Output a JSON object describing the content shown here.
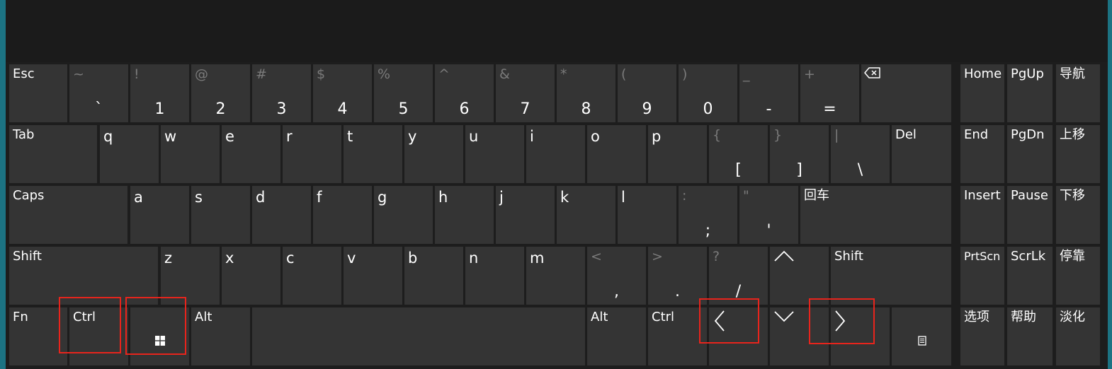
{
  "keys": {
    "esc": "Esc",
    "backtick_top": "~",
    "backtick_bottom": "`",
    "k1_top": "!",
    "k1_bottom": "1",
    "k2_top": "@",
    "k2_bottom": "2",
    "k3_top": "#",
    "k3_bottom": "3",
    "k4_top": "$",
    "k4_bottom": "4",
    "k5_top": "%",
    "k5_bottom": "5",
    "k6_top": "^",
    "k6_bottom": "6",
    "k7_top": "&",
    "k7_bottom": "7",
    "k8_top": "*",
    "k8_bottom": "8",
    "k9_top": "(",
    "k9_bottom": "9",
    "k0_top": ")",
    "k0_bottom": "0",
    "minus_top": "_",
    "minus_bottom": "-",
    "equal_top": "+",
    "equal_bottom": "=",
    "tab": "Tab",
    "q": "q",
    "w": "w",
    "e": "e",
    "r": "r",
    "t": "t",
    "y": "y",
    "u": "u",
    "i": "i",
    "o": "o",
    "p": "p",
    "lbracket_top": "{",
    "lbracket_bottom": "[",
    "rbracket_top": "}",
    "rbracket_bottom": "]",
    "backslash_top": "|",
    "backslash_bottom": "\\",
    "del": "Del",
    "caps": "Caps",
    "a": "a",
    "s": "s",
    "d": "d",
    "f": "f",
    "g": "g",
    "h": "h",
    "j": "j",
    "k": "k",
    "l": "l",
    "semicolon_top": ":",
    "semicolon_bottom": ";",
    "quote_top": "\"",
    "quote_bottom": "'",
    "enter": "回车",
    "shift_left": "Shift",
    "z": "z",
    "x": "x",
    "c": "c",
    "v": "v",
    "b": "b",
    "n": "n",
    "m": "m",
    "comma_top": "<",
    "comma_bottom": ",",
    "period_top": ">",
    "period_bottom": ".",
    "slash_top": "?",
    "slash_bottom": "/",
    "shift_right": "Shift",
    "fn": "Fn",
    "ctrl_left": "Ctrl",
    "alt_left": "Alt",
    "alt_right": "Alt",
    "ctrl_right": "Ctrl"
  },
  "nav": {
    "home": "Home",
    "pgup": "PgUp",
    "navigate": "导航",
    "end": "End",
    "pgdn": "PgDn",
    "move_up": "上移",
    "insert": "Insert",
    "pause": "Pause",
    "move_down": "下移",
    "prtscn": "PrtScn",
    "scrlk": "ScrLk",
    "dock": "停靠",
    "options": "选项",
    "help": "帮助",
    "fade": "淡化"
  },
  "icons": {
    "backspace": "backspace-icon",
    "windows": "windows-logo-icon",
    "up": "arrow-up-icon",
    "left": "arrow-left-icon",
    "down": "arrow-down-icon",
    "right": "arrow-right-icon",
    "menu": "context-menu-icon"
  },
  "colors": {
    "key_bg": "#343434",
    "page_bg": "#1a1a1a",
    "side_bar": "#1c7383",
    "highlight": "#e8241c",
    "secondary_text": "#7a7a7a"
  }
}
